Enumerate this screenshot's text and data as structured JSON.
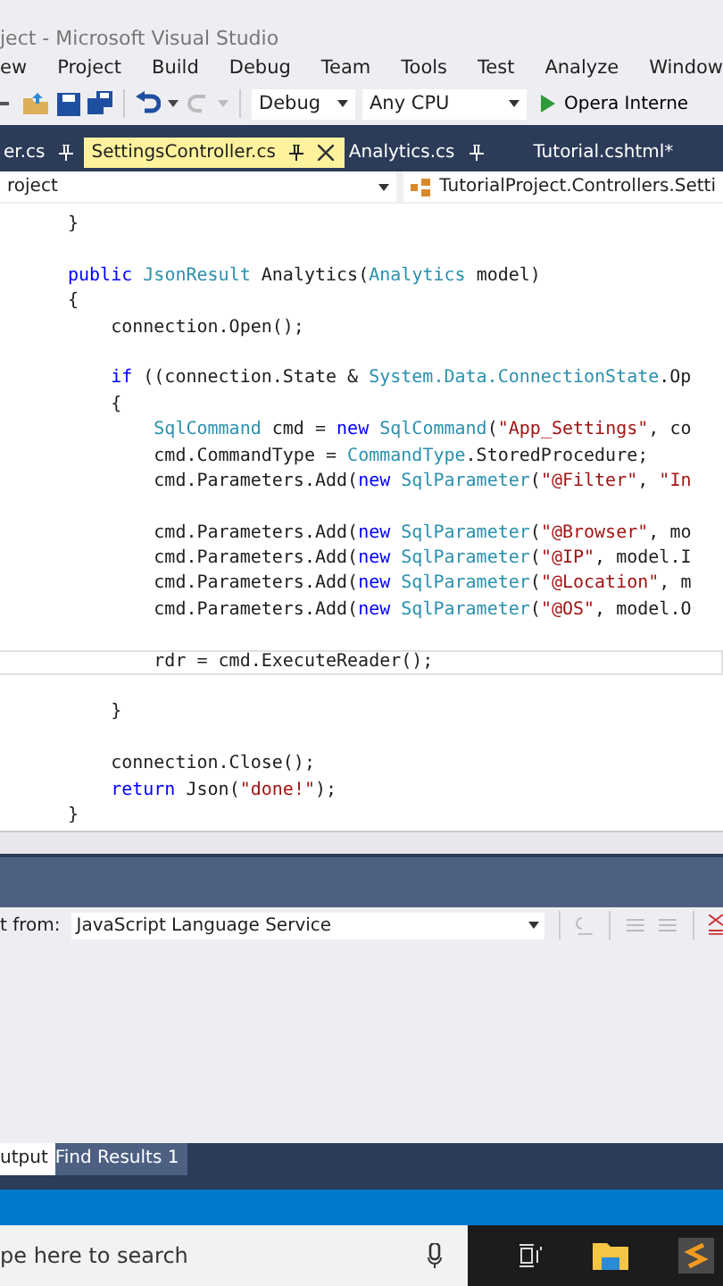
{
  "window": {
    "title": "ject - Microsoft Visual Studio"
  },
  "menu": [
    "ew",
    "Project",
    "Build",
    "Debug",
    "Team",
    "Tools",
    "Test",
    "Analyze",
    "Window"
  ],
  "toolbar": {
    "configuration": "Debug",
    "platform": "Any CPU",
    "run_target": "Opera Interne"
  },
  "tabs": [
    {
      "label": "er.cs",
      "selected": false,
      "pinned": true
    },
    {
      "label": "SettingsController.cs",
      "selected": true,
      "pinned": true
    },
    {
      "label": "Analytics.cs",
      "selected": false,
      "pinned": true
    },
    {
      "label": "Tutorial.cshtml*",
      "selected": false,
      "pinned": false
    }
  ],
  "navigation": {
    "project": "roject",
    "member": "TutorialProject.Controllers.Setti"
  },
  "code": {
    "lines": [
      {
        "current": false,
        "tokens": [
          {
            "kind": "plain",
            "text": "}"
          }
        ]
      },
      {
        "current": false
      },
      {
        "current": false,
        "tokens": [
          {
            "kind": "keyword",
            "text": "public "
          },
          {
            "kind": "type",
            "text": "JsonResult"
          },
          {
            "kind": "plain",
            "text": " Analytics("
          },
          {
            "kind": "type",
            "text": "Analytics"
          },
          {
            "kind": "plain",
            "text": " model)"
          }
        ]
      },
      {
        "current": false,
        "tokens": [
          {
            "kind": "plain",
            "text": "{"
          }
        ]
      },
      {
        "current": false,
        "tokens": [
          {
            "kind": "plain",
            "text": "    connection.Open();"
          }
        ]
      },
      {
        "current": false
      },
      {
        "current": false,
        "tokens": [
          {
            "kind": "keyword",
            "text": "    if"
          },
          {
            "kind": "plain",
            "text": " ((connection.State & "
          },
          {
            "kind": "type",
            "text": "System.Data.ConnectionState"
          },
          {
            "kind": "plain",
            "text": ".Op"
          }
        ]
      },
      {
        "current": false,
        "tokens": [
          {
            "kind": "plain",
            "text": "    {"
          }
        ]
      },
      {
        "current": false,
        "tokens": [
          {
            "kind": "type",
            "text": "        SqlCommand"
          },
          {
            "kind": "plain",
            "text": " cmd = "
          },
          {
            "kind": "keyword",
            "text": "new "
          },
          {
            "kind": "type",
            "text": "SqlCommand"
          },
          {
            "kind": "plain",
            "text": "("
          },
          {
            "kind": "string",
            "text": "\"App_Settings\""
          },
          {
            "kind": "plain",
            "text": ", co"
          }
        ]
      },
      {
        "current": false,
        "tokens": [
          {
            "kind": "plain",
            "text": "        cmd.CommandType = "
          },
          {
            "kind": "type",
            "text": "CommandType"
          },
          {
            "kind": "plain",
            "text": ".StoredProcedure;"
          }
        ]
      },
      {
        "current": false,
        "tokens": [
          {
            "kind": "plain",
            "text": "        cmd.Parameters.Add("
          },
          {
            "kind": "keyword",
            "text": "new "
          },
          {
            "kind": "type",
            "text": "SqlParameter"
          },
          {
            "kind": "plain",
            "text": "("
          },
          {
            "kind": "string",
            "text": "\"@Filter\""
          },
          {
            "kind": "plain",
            "text": ", "
          },
          {
            "kind": "string",
            "text": "\"In"
          }
        ]
      },
      {
        "current": false
      },
      {
        "current": false,
        "tokens": [
          {
            "kind": "plain",
            "text": "        cmd.Parameters.Add("
          },
          {
            "kind": "keyword",
            "text": "new "
          },
          {
            "kind": "type",
            "text": "SqlParameter"
          },
          {
            "kind": "plain",
            "text": "("
          },
          {
            "kind": "string",
            "text": "\"@Browser\""
          },
          {
            "kind": "plain",
            "text": ", mo"
          }
        ]
      },
      {
        "current": false,
        "tokens": [
          {
            "kind": "plain",
            "text": "        cmd.Parameters.Add("
          },
          {
            "kind": "keyword",
            "text": "new "
          },
          {
            "kind": "type",
            "text": "SqlParameter"
          },
          {
            "kind": "plain",
            "text": "("
          },
          {
            "kind": "string",
            "text": "\"@IP\""
          },
          {
            "kind": "plain",
            "text": ", model.I"
          }
        ]
      },
      {
        "current": false,
        "tokens": [
          {
            "kind": "plain",
            "text": "        cmd.Parameters.Add("
          },
          {
            "kind": "keyword",
            "text": "new "
          },
          {
            "kind": "type",
            "text": "SqlParameter"
          },
          {
            "kind": "plain",
            "text": "("
          },
          {
            "kind": "string",
            "text": "\"@Location\""
          },
          {
            "kind": "plain",
            "text": ", m"
          }
        ]
      },
      {
        "current": false,
        "tokens": [
          {
            "kind": "plain",
            "text": "        cmd.Parameters.Add("
          },
          {
            "kind": "keyword",
            "text": "new "
          },
          {
            "kind": "type",
            "text": "SqlParameter"
          },
          {
            "kind": "plain",
            "text": "("
          },
          {
            "kind": "string",
            "text": "\"@OS\""
          },
          {
            "kind": "plain",
            "text": ", model.O"
          }
        ]
      },
      {
        "current": false
      },
      {
        "current": true,
        "tokens": [
          {
            "kind": "plain",
            "text": "        rdr = cmd.ExecuteReader();"
          }
        ]
      },
      {
        "current": false
      },
      {
        "current": false,
        "tokens": [
          {
            "kind": "plain",
            "text": "    }"
          }
        ]
      },
      {
        "current": false
      },
      {
        "current": false,
        "tokens": [
          {
            "kind": "plain",
            "text": "    connection.Close();"
          }
        ]
      },
      {
        "current": false,
        "tokens": [
          {
            "kind": "keyword",
            "text": "    return"
          },
          {
            "kind": "plain",
            "text": " Json("
          },
          {
            "kind": "string",
            "text": "\"done!\""
          },
          {
            "kind": "plain",
            "text": ");"
          }
        ]
      },
      {
        "current": false,
        "tokens": [
          {
            "kind": "plain",
            "text": "}"
          }
        ]
      }
    ]
  },
  "output": {
    "label": "t from:",
    "source": "JavaScript Language Service"
  },
  "bottom_tabs": [
    {
      "label": "utput",
      "selected": true
    },
    {
      "label": "Find Results 1",
      "selected": false
    }
  ],
  "taskbar": {
    "search_placeholder": "pe here to search"
  }
}
